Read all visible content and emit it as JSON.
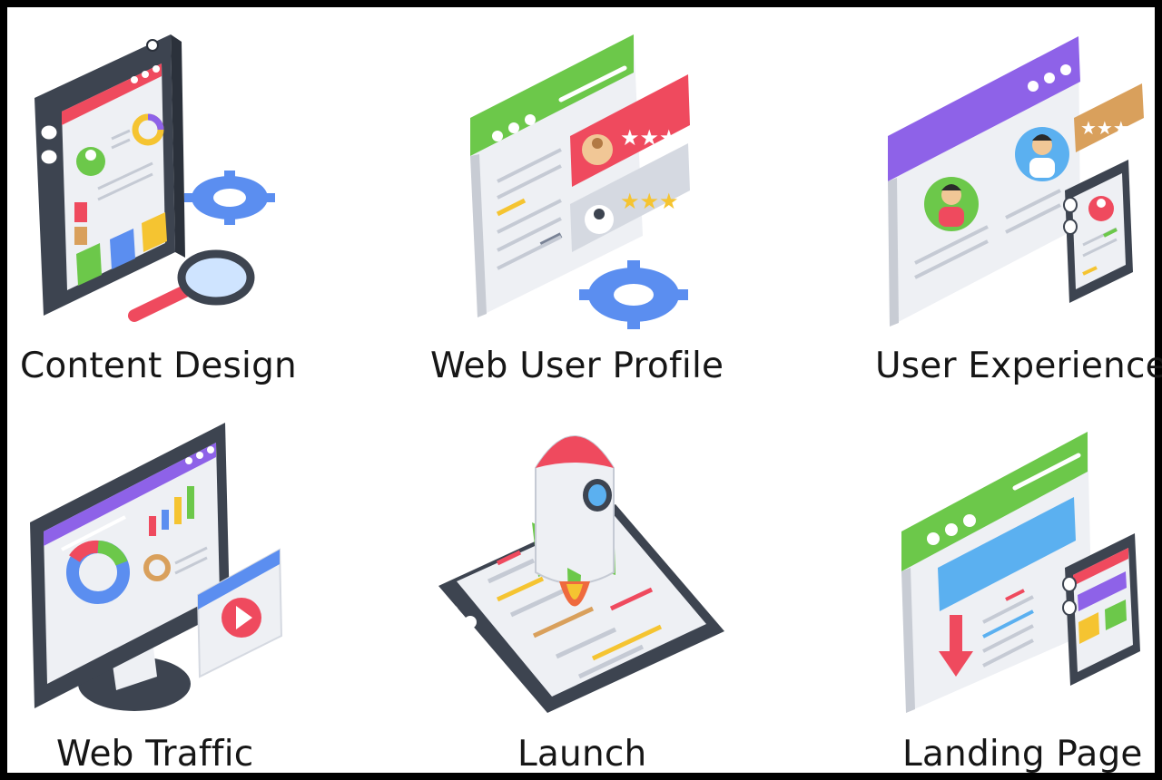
{
  "items": [
    {
      "label": "Content Design",
      "icon": "mobile-content-design-icon"
    },
    {
      "label": "Web User Profile",
      "icon": "web-user-profile-icon"
    },
    {
      "label": "User Experience",
      "icon": "user-experience-icon"
    },
    {
      "label": "Web Traffic",
      "icon": "web-traffic-monitor-icon"
    },
    {
      "label": "Launch",
      "icon": "rocket-launch-icon"
    },
    {
      "label": "Landing Page",
      "icon": "landing-page-icon"
    }
  ],
  "colors": {
    "dark": "#3d4450",
    "green": "#6cc84a",
    "purple": "#8e62e8",
    "blue": "#5b8ef0",
    "red": "#ef4a5e",
    "yellow": "#f5c431",
    "light": "#eef0f4"
  }
}
